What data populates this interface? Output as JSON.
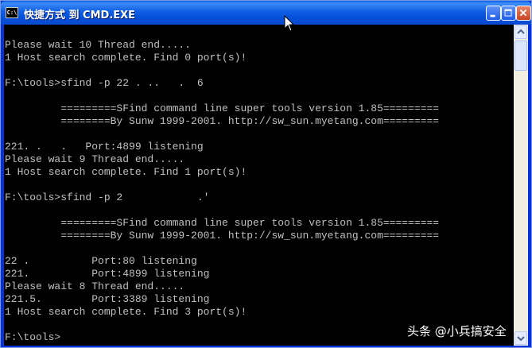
{
  "window": {
    "icon_text": "C:\\",
    "title": "快捷方式 到 CMD.EXE"
  },
  "console": {
    "text": "\nPlease wait 10 Thread end.....\n1 Host search complete. Find 0 port(s)!\n\nF:\\tools>sfind -p 22 . ..   .  6\n\n         =========SFind command line super tools version 1.85=========\n         ========By Sunw 1999-2001. http://sw_sun.myetang.com=========\n\n221. .   .   Port:4899 listening\nPlease wait 9 Thread end.....\n1 Host search complete. Find 1 port(s)!\n\nF:\\tools>sfind -p 2            .'\n\n         =========SFind command line super tools version 1.85=========\n         ========By Sunw 1999-2001. http://sw_sun.myetang.com=========\n\n22 .          Port:80 listening\n221.          Port:4899 listening\nPlease wait 8 Thread end.....\n221.5.        Port:3389 listening\n1 Host search complete. Find 3 port(s)!\n\nF:\\tools>"
  },
  "watermark": {
    "text": "头条 @小兵搞安全"
  }
}
